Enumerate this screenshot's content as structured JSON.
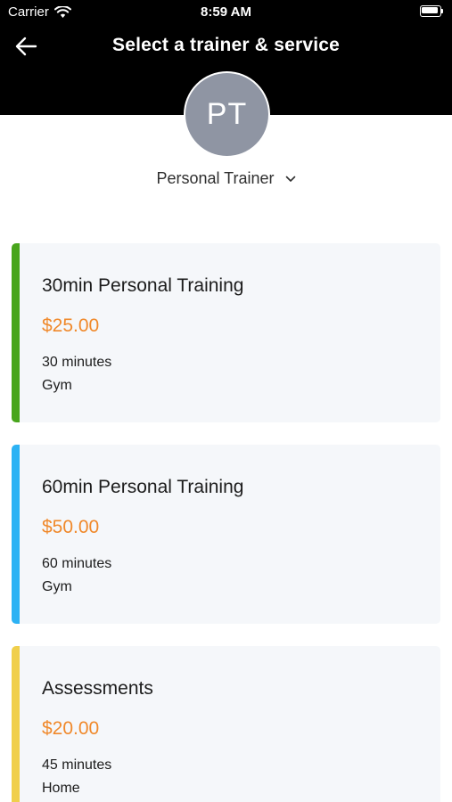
{
  "status_bar": {
    "carrier": "Carrier",
    "time": "8:59 AM",
    "wifi_icon": "wifi-icon",
    "battery_icon": "battery-icon"
  },
  "nav": {
    "back_icon": "arrow-left-icon",
    "title": "Select a trainer & service"
  },
  "trainer": {
    "initials": "PT",
    "name": "Personal Trainer",
    "dropdown_icon": "chevron-down-icon"
  },
  "colors": {
    "header": "#000000",
    "avatar": "#8f95a3",
    "price": "#f0892b",
    "card_background": "#f5f7fa"
  },
  "services": [
    {
      "title": "30min Personal Training",
      "price": "$25.00",
      "duration": "30 minutes",
      "location": "Gym",
      "accent_color": "#48a51c"
    },
    {
      "title": "60min Personal Training",
      "price": "$50.00",
      "duration": "60 minutes",
      "location": "Gym",
      "accent_color": "#2cb2f4"
    },
    {
      "title": "Assessments",
      "price": "$20.00",
      "duration": "45 minutes",
      "location": "Home",
      "accent_color": "#f0cf4c"
    }
  ]
}
